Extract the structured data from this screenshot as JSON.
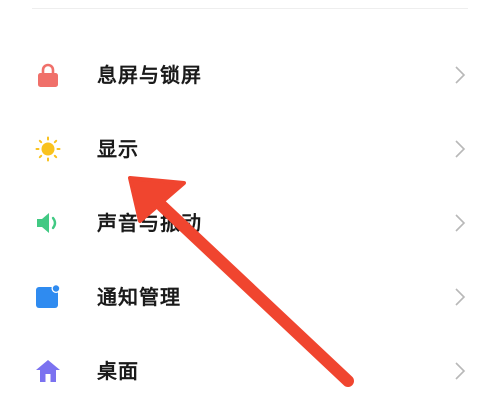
{
  "settings": {
    "items": [
      {
        "label": "息屏与锁屏",
        "icon": "lock-icon",
        "color": "#F0706A"
      },
      {
        "label": "显示",
        "icon": "sun-icon",
        "color": "#F9C21E"
      },
      {
        "label": "声音与振动",
        "icon": "speaker-icon",
        "color": "#41C983"
      },
      {
        "label": "通知管理",
        "icon": "notification-icon",
        "color": "#2F8BF0"
      },
      {
        "label": "桌面",
        "icon": "home-icon",
        "color": "#7B72F0"
      }
    ]
  },
  "annotation": {
    "arrow_color": "#F0452F"
  }
}
